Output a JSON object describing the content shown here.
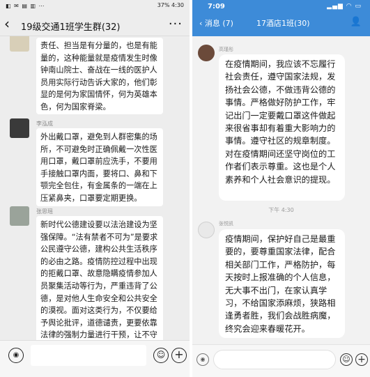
{
  "left": {
    "status_bar": {
      "left_text": "◧ ✉ ▤ ▥ ⋯",
      "right_text": "37% 4:30",
      "battery": "37%",
      "time": "4:30"
    },
    "header": {
      "back_icon": "chevron-left-icon",
      "title": "19级交通1班学生群(32)",
      "more_icon": "more-dots-icon"
    },
    "messages": [
      {
        "sender": "",
        "text": "责任、担当是有分量的，也是有能量的，这种能量就是疫情发生时像钟南山院士、奋战在一线的医护人员用实际行动告诉大家的，他们彰显的是何为家国情怀，何为英雄本色，何为国家脊梁。"
      },
      {
        "sender": "李泓成",
        "text": "外出戴口罩，避免到人群密集的场所，不可避免时正确佩戴一次性医用口罩，戴口罩前应洗手，不要用手接触口罩内面，要将口、鼻和下颚完全包住，有金属条的一端在上压紧鼻夹，口罩要定期更换。"
      },
      {
        "sender": "张思瑶",
        "text": "新时代公德建设要以法治建设为坚强保障。“法有禁者不可为”是要求公民遵守公德，建构公共生活秩序的必由之路。疫情防控过程中出现的拒戴口罩、故意隐瞒疫情参加人员聚集活动等行为，严重违背了公德，是对他人生命安全和公共安全的漠视。面对这类行为，不仅要给予舆论批评，道德谴责，更要依靠法律的强制力量进行干预，让不守公德者付出代价，受到严厉惩处。"
      }
    ],
    "input_bar": {
      "voice_icon": "voice-icon",
      "emoji_icon": "emoji-icon",
      "plus_icon": "plus-icon"
    }
  },
  "right": {
    "status_bar": {
      "time": "7:09",
      "icons_text": "▂▄▆ ◠ ▭"
    },
    "header": {
      "back_text": "‹ 消息 (7)",
      "title": "17酒店1班(30)",
      "contact_icon": "contact-icon"
    },
    "messages": [
      {
        "sender": "高瑾彤",
        "text": "在疫情期间，我应该不忘履行社会责任，遵守国家法规，发扬社会公德，不做违背公德的事情。严格做好防护工作，牢记出门一定要戴口罩这件做起来很省事却有着重大影响力的事情。遵守社区的规章制度。对在疫情期间还坚守岗位的工作者们表示尊重。这也是个人素养和个人社会意识的提现。"
      },
      {
        "sender": "张悦凯",
        "text": "疫情期间，保护好自己是最重要的，要尊重国家法律，配合相关部门工作，严格防护，每天按时上报准确的个人信息，无大事不出门，在家认真学习，不给国家添麻烦，狭路相逢勇者胜，我们会战胜病魔，终究会迎来春暖花开。"
      }
    ],
    "timestamp": "下午 4:30",
    "input_bar": {
      "voice_icon": "voice-icon",
      "emoji_icon": "emoji-icon",
      "plus_icon": "plus-icon"
    }
  }
}
